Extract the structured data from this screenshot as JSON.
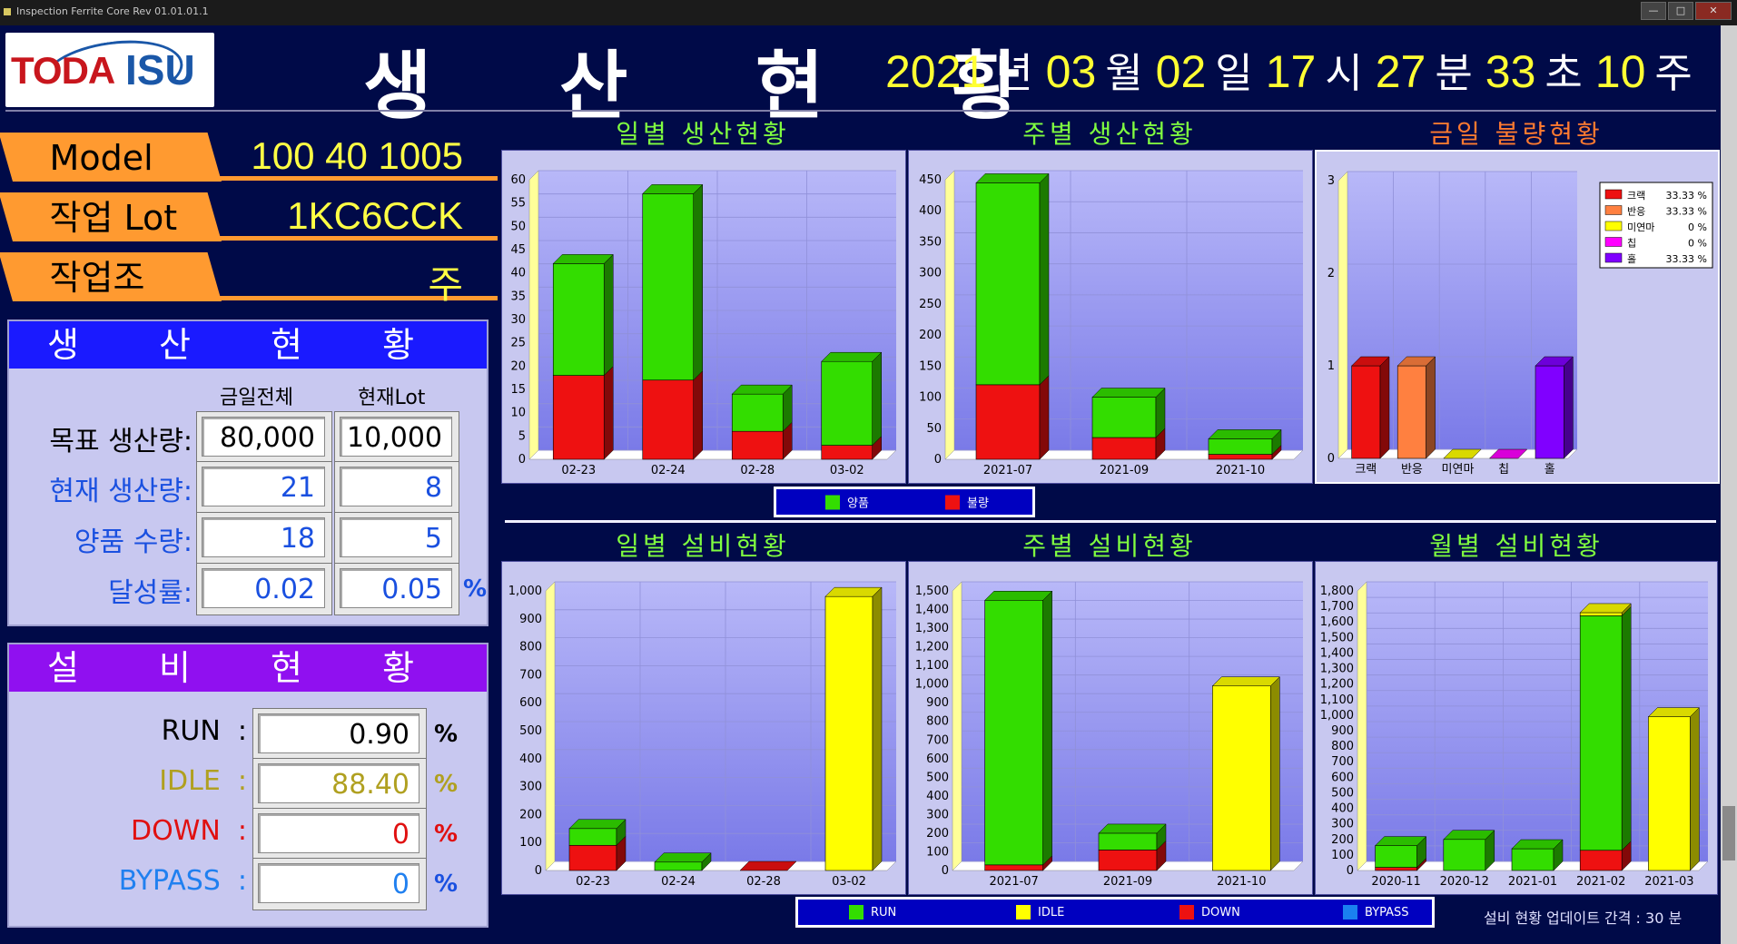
{
  "window": {
    "title": "Inspection Ferrite Core  Rev 01.01.01.1"
  },
  "header": {
    "logo_left": "TODA",
    "logo_right": "ISU",
    "title": "생 산 현 황",
    "datetime": {
      "year": "2021",
      "year_unit": "년",
      "month": "03",
      "month_unit": "월",
      "day": "02",
      "day_unit": "일",
      "hour": "17",
      "hour_unit": "시",
      "minute": "27",
      "minute_unit": "분",
      "second": "33",
      "second_unit": "초",
      "week": "10",
      "week_unit": "주"
    }
  },
  "info": {
    "model_label": "Model",
    "model_value": "100  40  1005",
    "lot_label": "작업 Lot",
    "lot_value": "1KC6CCK",
    "team_label": "작업조",
    "team_value": "주"
  },
  "production": {
    "title": "생 산 현 황",
    "col_today": "금일전체",
    "col_lot": "현재Lot",
    "rows": [
      {
        "label": "목표 생산량:",
        "today": "80,000",
        "lot": "10,000",
        "color": "#000000"
      },
      {
        "label": "현재 생산량:",
        "today": "21",
        "lot": "8",
        "color": "#1a50e0"
      },
      {
        "label": "양품 수량:",
        "today": "18",
        "lot": "5",
        "color": "#1a50e0"
      },
      {
        "label": "달성률:",
        "today": "0.02",
        "lot": "0.05",
        "color": "#1a50e0"
      }
    ],
    "pct_symbol": "%"
  },
  "equipment": {
    "title": "설 비 현 황",
    "rows": [
      {
        "label": "RUN  :",
        "value": "0.90",
        "color": "#000000"
      },
      {
        "label": "IDLE  :",
        "value": "88.40",
        "color": "#b0a020"
      },
      {
        "label": "DOWN  :",
        "value": "0",
        "color": "#e01010"
      },
      {
        "label": "BYPASS  :",
        "value": "0",
        "color": "#2080f0"
      }
    ],
    "pct_symbol": "%",
    "pct_colors": [
      "#000000",
      "#b0a020",
      "#e01010",
      "#1a50e0"
    ]
  },
  "legends": {
    "production": [
      {
        "label": "양품",
        "color": "#33dd00"
      },
      {
        "label": "불량",
        "color": "#ee1111"
      }
    ],
    "equipment": [
      {
        "label": "RUN",
        "color": "#33dd00"
      },
      {
        "label": "IDLE",
        "color": "#ffff00"
      },
      {
        "label": "DOWN",
        "color": "#ee1111"
      },
      {
        "label": "BYPASS",
        "color": "#1a80f0"
      }
    ]
  },
  "footer": {
    "update_interval": "설비 현황 업데이트 간격 :   30 분"
  },
  "chart_data": [
    {
      "id": "daily-production",
      "title": "일별 생산현황",
      "type": "bar",
      "stacked": true,
      "categories": [
        "02-23",
        "02-24",
        "02-28",
        "03-02"
      ],
      "series": [
        {
          "name": "양품",
          "values": [
            24,
            40,
            8,
            18
          ]
        },
        {
          "name": "불량",
          "values": [
            18,
            17,
            6,
            3
          ]
        }
      ],
      "ylim": [
        0,
        60
      ],
      "yticks": [
        0,
        5,
        10,
        15,
        20,
        25,
        30,
        35,
        40,
        45,
        50,
        55,
        60
      ]
    },
    {
      "id": "weekly-production",
      "title": "주별 생산현황",
      "type": "bar",
      "stacked": true,
      "categories": [
        "2021-07",
        "2021-09",
        "2021-10"
      ],
      "series": [
        {
          "name": "양품",
          "values": [
            325,
            65,
            25
          ]
        },
        {
          "name": "불량",
          "values": [
            120,
            35,
            8
          ]
        }
      ],
      "ylim": [
        0,
        450
      ],
      "yticks": [
        0,
        50,
        100,
        150,
        200,
        250,
        300,
        350,
        400,
        450
      ]
    },
    {
      "id": "today-defects",
      "title": "금일 불량현황",
      "type": "bar",
      "categories": [
        "크랙",
        "반응",
        "미연마",
        "칩",
        "홀"
      ],
      "values": [
        1,
        1,
        0,
        0,
        1
      ],
      "colors": [
        "#ee1111",
        "#ff8040",
        "#ffff00",
        "#ff00ff",
        "#8000ff"
      ],
      "legend": [
        {
          "label": "크랙",
          "pct": "33.33 %"
        },
        {
          "label": "반응",
          "pct": "33.33 %"
        },
        {
          "label": "미연마",
          "pct": "0 %"
        },
        {
          "label": "칩",
          "pct": "0 %"
        },
        {
          "label": "홀",
          "pct": "33.33 %"
        }
      ],
      "ylim": [
        0,
        3
      ],
      "yticks": [
        0,
        1,
        2,
        3
      ]
    },
    {
      "id": "daily-equipment",
      "title": "일별 설비현황",
      "type": "bar",
      "stacked": true,
      "categories": [
        "02-23",
        "02-24",
        "02-28",
        "03-02"
      ],
      "series": [
        {
          "name": "RUN",
          "values": [
            60,
            30,
            0,
            0
          ]
        },
        {
          "name": "DOWN",
          "values": [
            90,
            0,
            0,
            0
          ]
        },
        {
          "name": "IDLE",
          "values": [
            0,
            0,
            0,
            980
          ]
        }
      ],
      "ylim": [
        0,
        1000
      ],
      "yticks": [
        0,
        100,
        200,
        300,
        400,
        500,
        600,
        700,
        800,
        900,
        1000
      ]
    },
    {
      "id": "weekly-equipment",
      "title": "주별 설비현황",
      "type": "bar",
      "stacked": true,
      "categories": [
        "2021-07",
        "2021-09",
        "2021-10"
      ],
      "series": [
        {
          "name": "RUN",
          "values": [
            1420,
            90,
            0
          ]
        },
        {
          "name": "DOWN",
          "values": [
            30,
            110,
            0
          ]
        },
        {
          "name": "IDLE",
          "values": [
            0,
            0,
            990
          ]
        }
      ],
      "ylim": [
        0,
        1500
      ],
      "yticks": [
        0,
        100,
        200,
        300,
        400,
        500,
        600,
        700,
        800,
        900,
        1000,
        1100,
        1200,
        1300,
        1400,
        1500
      ]
    },
    {
      "id": "monthly-equipment",
      "title": "월별 설비현황",
      "type": "bar",
      "stacked": true,
      "categories": [
        "2020-11",
        "2020-12",
        "2021-01",
        "2021-02",
        "2021-03"
      ],
      "series": [
        {
          "name": "RUN",
          "values": [
            140,
            200,
            140,
            1510,
            0
          ]
        },
        {
          "name": "DOWN",
          "values": [
            20,
            0,
            0,
            130,
            0
          ]
        },
        {
          "name": "IDLE",
          "values": [
            0,
            0,
            0,
            20,
            990
          ]
        }
      ],
      "ylim": [
        0,
        1800
      ],
      "yticks": [
        0,
        100,
        200,
        300,
        400,
        500,
        600,
        700,
        800,
        900,
        1000,
        1100,
        1200,
        1300,
        1400,
        1500,
        1600,
        1700,
        1800
      ]
    }
  ]
}
